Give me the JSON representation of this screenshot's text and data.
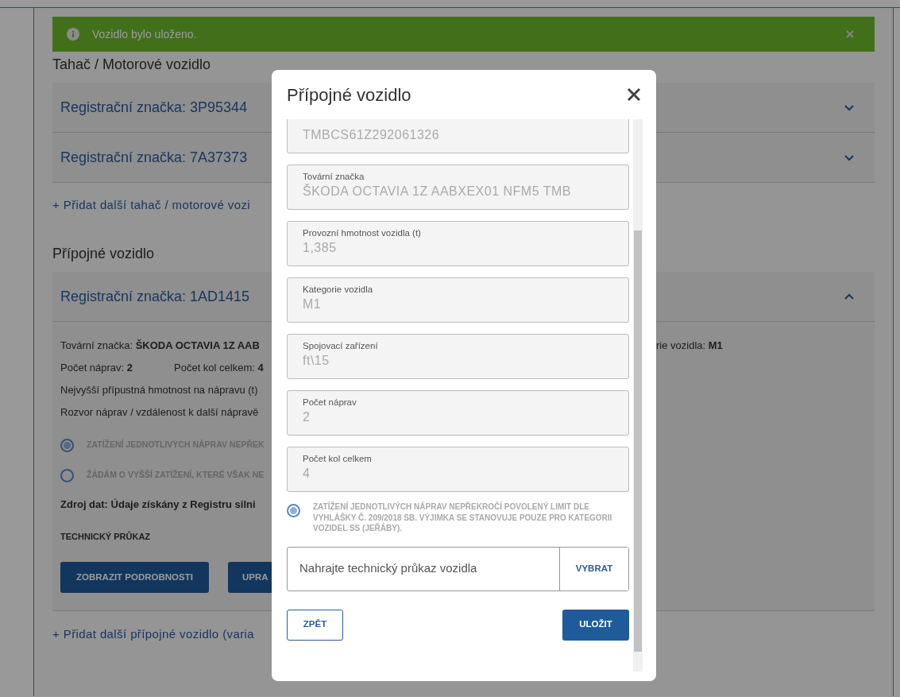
{
  "alert": {
    "message": "Vozidlo bylo uloženo."
  },
  "sections": [
    {
      "heading": "Tahač / Motorové vozidlo",
      "vehicles": [
        {
          "title": "Registrační značka: 3P95344",
          "expanded": false
        },
        {
          "title": "Registrační značka: 7A37373",
          "expanded": false
        }
      ],
      "add_link": "+ Přidat další tahač / motorové vozi"
    },
    {
      "heading": "Přípojné vozidlo",
      "vehicles": [
        {
          "title": "Registrační značka: 1AD1415",
          "expanded": true,
          "details": {
            "rows": [
              {
                "left": [
                  "Tovární značka: **ŠKODA OCTAVIA 1Z AAB**"
                ],
                "right": "rie vozidla: **M1**"
              },
              {
                "left": [
                  "Počet náprav: **2**",
                  "Počet kol celkem: **4**"
                ]
              },
              {
                "left": [
                  "Nejvyšší přípustná hmotnost na nápravu (t)"
                ]
              },
              {
                "left": [
                  "Rozvor náprav / vzdálenost k další nápravě"
                ]
              }
            ],
            "radios": [
              {
                "label": "ZATÍŽENÍ JEDNOTLIVÝCH NÁPRAV NEPŘEK",
                "selected": true
              },
              {
                "label": "ŽÁDÁM O VYŠŠÍ ZATÍŽENÍ, KTERÉ VŠAK NE",
                "selected": false
              }
            ],
            "source": "Zdroj dat: Údaje získány z Registru silni",
            "doc_heading": "TECHNICKÝ PRŮKAZ",
            "buttons": [
              "ZOBRAZIT PODROBNOSTI",
              "UPRA"
            ]
          }
        }
      ],
      "add_link": "+ Přidat další přípojné vozidlo (varia"
    }
  ],
  "modal": {
    "title": "Přípojné vozidlo",
    "fields": [
      {
        "value": "TMBCS61Z292061326"
      },
      {
        "label": "Tovární značka",
        "value": "ŠKODA OCTAVIA 1Z AABXEX01 NFM5 TMB"
      },
      {
        "label": "Provozní hmotnost vozidla (t)",
        "value": "1,385"
      },
      {
        "label": "Kategorie vozidla",
        "value": "M1"
      },
      {
        "label": "Spojovací zařízení",
        "value": "ft\\15"
      },
      {
        "label": "Počet náprav",
        "value": "2"
      },
      {
        "label": "Počet kol celkem",
        "value": "4"
      }
    ],
    "radio": {
      "label": "ZATÍŽENÍ JEDNOTLIVÝCH NÁPRAV NEPŘEKROČÍ POVOLENÝ LIMIT DLE VYHLÁŠKY Č. 209/2018 SB. VÝJIMKA SE STANOVUJE POUZE PRO KATEGORII VOZIDEL SS (JEŘÁBY).",
      "selected": true
    },
    "upload": {
      "placeholder": "Nahrajte technický průkaz vozidla",
      "button": "VYBRAT"
    },
    "back_button": "ZPĚT",
    "save_button": "ULOŽIT"
  }
}
